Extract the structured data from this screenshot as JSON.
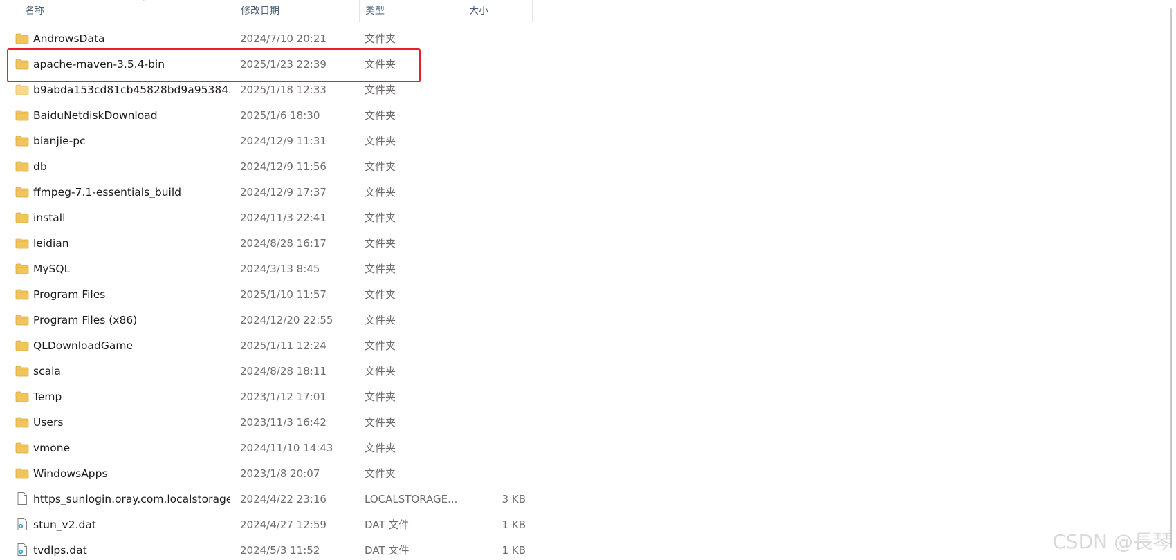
{
  "columns": {
    "name": "名称",
    "date": "修改日期",
    "type": "类型",
    "size": "大小"
  },
  "sort_indicator": "^",
  "colors": {
    "folder": "#f2c55c",
    "folder_light": "#f7d98a",
    "highlight": "#e8202a"
  },
  "files": [
    {
      "name": "AndrowsData",
      "date": "2024/7/10 20:21",
      "type": "文件夹",
      "size": "",
      "icon": "folder-icon"
    },
    {
      "name": "apache-maven-3.5.4-bin",
      "date": "2025/1/23 22:39",
      "type": "文件夹",
      "size": "",
      "icon": "folder-icon"
    },
    {
      "name": "b9abda153cd81cb45828bd9a95384...",
      "date": "2025/1/18 12:33",
      "type": "文件夹",
      "size": "",
      "icon": "folder-light-icon"
    },
    {
      "name": "BaiduNetdiskDownload",
      "date": "2025/1/6 18:30",
      "type": "文件夹",
      "size": "",
      "icon": "folder-icon"
    },
    {
      "name": "bianjie-pc",
      "date": "2024/12/9 11:31",
      "type": "文件夹",
      "size": "",
      "icon": "folder-icon"
    },
    {
      "name": "db",
      "date": "2024/12/9 11:56",
      "type": "文件夹",
      "size": "",
      "icon": "folder-icon"
    },
    {
      "name": "ffmpeg-7.1-essentials_build",
      "date": "2024/12/9 17:37",
      "type": "文件夹",
      "size": "",
      "icon": "folder-icon"
    },
    {
      "name": "install",
      "date": "2024/11/3 22:41",
      "type": "文件夹",
      "size": "",
      "icon": "folder-icon"
    },
    {
      "name": "leidian",
      "date": "2024/8/28 16:17",
      "type": "文件夹",
      "size": "",
      "icon": "folder-icon"
    },
    {
      "name": "MySQL",
      "date": "2024/3/13 8:45",
      "type": "文件夹",
      "size": "",
      "icon": "folder-icon"
    },
    {
      "name": "Program Files",
      "date": "2025/1/10 11:57",
      "type": "文件夹",
      "size": "",
      "icon": "folder-icon"
    },
    {
      "name": "Program Files (x86)",
      "date": "2024/12/20 22:55",
      "type": "文件夹",
      "size": "",
      "icon": "folder-icon"
    },
    {
      "name": "QLDownloadGame",
      "date": "2025/1/11 12:24",
      "type": "文件夹",
      "size": "",
      "icon": "folder-icon"
    },
    {
      "name": "scala",
      "date": "2024/8/28 18:11",
      "type": "文件夹",
      "size": "",
      "icon": "folder-icon"
    },
    {
      "name": "Temp",
      "date": "2023/1/12 17:01",
      "type": "文件夹",
      "size": "",
      "icon": "folder-icon"
    },
    {
      "name": "Users",
      "date": "2023/11/3 16:42",
      "type": "文件夹",
      "size": "",
      "icon": "folder-icon"
    },
    {
      "name": "vmone",
      "date": "2024/11/10 14:43",
      "type": "文件夹",
      "size": "",
      "icon": "folder-icon"
    },
    {
      "name": "WindowsApps",
      "date": "2023/1/8 20:07",
      "type": "文件夹",
      "size": "",
      "icon": "folder-icon"
    },
    {
      "name": "https_sunlogin.oray.com.localstorage",
      "date": "2024/4/22 23:16",
      "type": "LOCALSTORAGE...",
      "size": "3 KB",
      "icon": "document-icon"
    },
    {
      "name": "stun_v2.dat",
      "date": "2024/4/27 12:59",
      "type": "DAT 文件",
      "size": "1 KB",
      "icon": "dat-file-icon"
    },
    {
      "name": "tvdlps.dat",
      "date": "2024/5/3 11:52",
      "type": "DAT 文件",
      "size": "1 KB",
      "icon": "dat-file-icon"
    }
  ],
  "watermark": "CSDN @長琴"
}
